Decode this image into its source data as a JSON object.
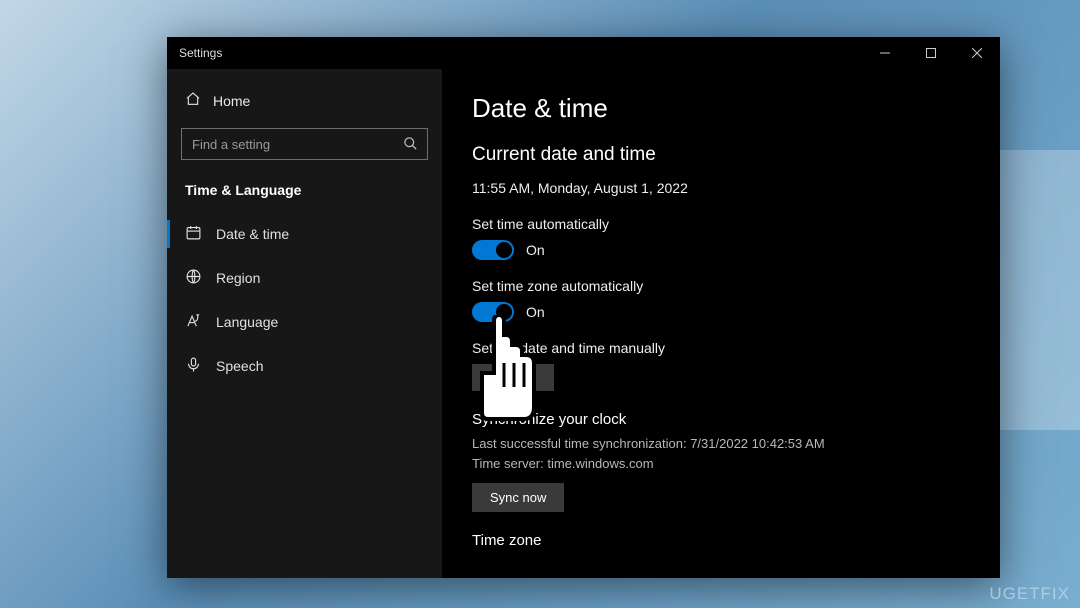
{
  "window": {
    "title": "Settings"
  },
  "sidebar": {
    "home": "Home",
    "search_placeholder": "Find a setting",
    "category": "Time & Language",
    "items": [
      {
        "label": "Date & time",
        "icon": "clock"
      },
      {
        "label": "Region",
        "icon": "globe"
      },
      {
        "label": "Language",
        "icon": "lang"
      },
      {
        "label": "Speech",
        "icon": "mic"
      }
    ]
  },
  "main": {
    "title": "Date & time",
    "section_current": "Current date and time",
    "current_value": "11:55 AM, Monday, August 1, 2022",
    "set_time_auto_label": "Set time automatically",
    "set_time_auto_state": "On",
    "set_tz_auto_label": "Set time zone automatically",
    "set_tz_auto_state": "On",
    "set_manual_label": "Set the date and time manually",
    "change_button": "Change",
    "sync_heading": "Synchronize your clock",
    "sync_last": "Last successful time synchronization: 7/31/2022 10:42:53 AM",
    "sync_server": "Time server: time.windows.com",
    "sync_button": "Sync now",
    "timezone_heading": "Time zone"
  },
  "watermark": "UGETFIX"
}
